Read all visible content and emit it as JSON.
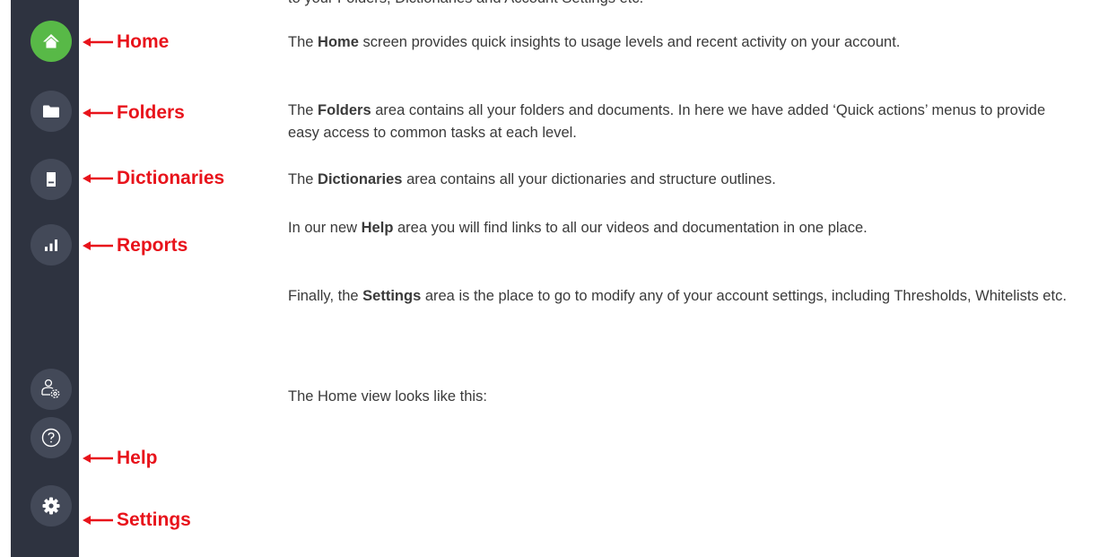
{
  "intro_cut": "to your Folders, Dictionaries and Account Settings etc.",
  "sidebar": {
    "background": "#2e3340",
    "accent": "#58b947",
    "items": [
      {
        "icon": "home-icon",
        "active": true
      },
      {
        "icon": "folder-icon"
      },
      {
        "icon": "book-icon"
      },
      {
        "icon": "bar-chart-icon"
      },
      {
        "icon": "user-settings-icon"
      },
      {
        "icon": "help-icon"
      },
      {
        "icon": "gear-icon"
      }
    ]
  },
  "callouts": {
    "color": "#e8131b",
    "home": "Home",
    "folders": "Folders",
    "dictionaries": "Dictionaries",
    "reports": "Reports",
    "help": "Help",
    "settings": "Settings"
  },
  "paragraphs": {
    "home": {
      "pre": "The ",
      "bold": "Home",
      "post": " screen provides quick insights to usage levels and recent activity on your account."
    },
    "folders": {
      "pre": "The ",
      "bold": "Folders",
      "post": " area contains all your folders and documents. In here we have added ‘Quick actions’ menus to provide easy access to common tasks at each level."
    },
    "dictionaries": {
      "pre": "The ",
      "bold": "Dictionaries",
      "post": " area contains all your dictionaries and structure outlines."
    },
    "help": {
      "pre": "In our new ",
      "bold": "Help",
      "post": " area you will find links to all our videos and documentation in one place."
    },
    "settings": {
      "pre": "Finally, the ",
      "bold": "Settings",
      "post": " area is the place to go to modify any of your account settings, including Thresholds, Whitelists etc."
    },
    "home_view": "The Home view looks like this:"
  }
}
